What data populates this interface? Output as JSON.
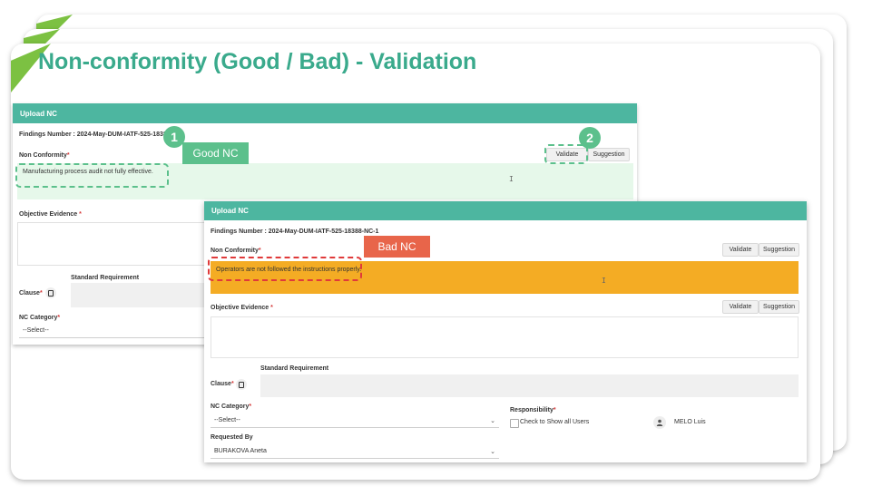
{
  "title": "Non-conformity (Good / Bad) - Validation",
  "annotations": {
    "step1": "1",
    "step2": "2",
    "good_tag": "Good NC",
    "bad_tag": "Bad NC"
  },
  "panel1": {
    "header": "Upload NC",
    "findings": "Findings Number : 2024-May-DUM-IATF-525-18388",
    "nc_label": "Non Conformity",
    "nc_value": "Manufacturing process audit not fully effective.",
    "validate": "Validate",
    "suggestion": "Suggestion",
    "evidence_label": "Objective Evidence",
    "std_req_label": "Standard Requirement",
    "clause_label": "Clause",
    "nc_category_label": "NC Category",
    "select_value": "--Select--"
  },
  "panel2": {
    "header": "Upload NC",
    "findings": "Findings Number : 2024-May-DUM-IATF-525-18388-NC-1",
    "nc_label": "Non Conformity",
    "nc_value": "Operators are not followed the instructions properly.",
    "validate": "Validate",
    "suggestion": "Suggestion",
    "evidence_label": "Objective Evidence",
    "evidence_validate": "Validate",
    "evidence_suggestion": "Suggestion",
    "std_req_label": "Standard Requirement",
    "clause_label": "Clause",
    "nc_category_label": "NC Category",
    "select_value": "--Select--",
    "responsibility_label": "Responsibility",
    "show_all_label": "Check to Show all Users",
    "user_name": "MELO Luis",
    "requested_by_label": "Requested By",
    "requested_by_value": "BURAKOVA Aneta"
  },
  "colors": {
    "teal": "#4db6a0",
    "title_green": "#3aaa8c",
    "good_bg": "#e6f8ea",
    "bad_bg": "#f4ac24",
    "required": "#d63b3b"
  }
}
